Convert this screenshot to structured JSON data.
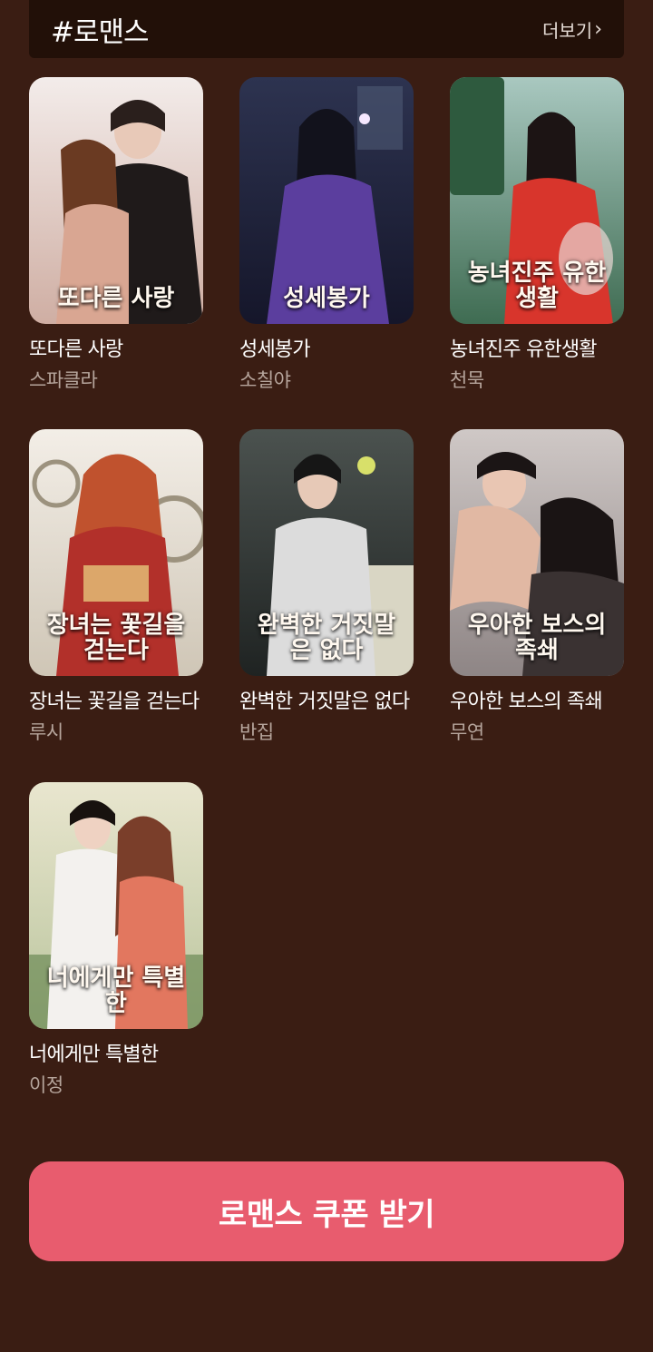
{
  "header": {
    "title": "#로맨스",
    "more_label": "더보기",
    "more_icon": "chevron-right-icon"
  },
  "books": [
    {
      "title": "또다른 사랑",
      "author": "스파클라",
      "cover_title": "또다른 사랑",
      "cover_colors": [
        "#f1e6e4",
        "#c8a79a",
        "#3a2a28"
      ]
    },
    {
      "title": "성세봉가",
      "author": "소칠야",
      "cover_title": "성세봉가",
      "cover_colors": [
        "#3a3a6a",
        "#6a4aa8",
        "#181a30"
      ]
    },
    {
      "title": "농녀진주 유한생활",
      "author": "천묵",
      "cover_title": "농녀진주 유한생활",
      "cover_colors": [
        "#6f9a8a",
        "#3c6b4a",
        "#d23a30"
      ]
    },
    {
      "title": "장녀는 꽃길을 걷는다",
      "author": "루시",
      "cover_title": "장녀는 꽃길을 걷는다",
      "cover_colors": [
        "#efe9e1",
        "#b6312a",
        "#8a7a60"
      ]
    },
    {
      "title": "완벽한 거짓말은 없다",
      "author": "반집",
      "cover_title": "완벽한 거짓말은 없다",
      "cover_colors": [
        "#3b4140",
        "#9aa39c",
        "#202424"
      ]
    },
    {
      "title": "우아한 보스의 족쇄",
      "author": "무연",
      "cover_title": "우아한 보스의 족쇄",
      "cover_colors": [
        "#a9a3a3",
        "#d8cfcc",
        "#262020"
      ]
    },
    {
      "title": "너에게만 특별한",
      "author": "이정",
      "cover_title": "너에게만 특별한",
      "cover_colors": [
        "#dcd9c2",
        "#c98a6a",
        "#5d7a4c"
      ]
    }
  ],
  "coupon_label": "로맨스 쿠폰 받기"
}
